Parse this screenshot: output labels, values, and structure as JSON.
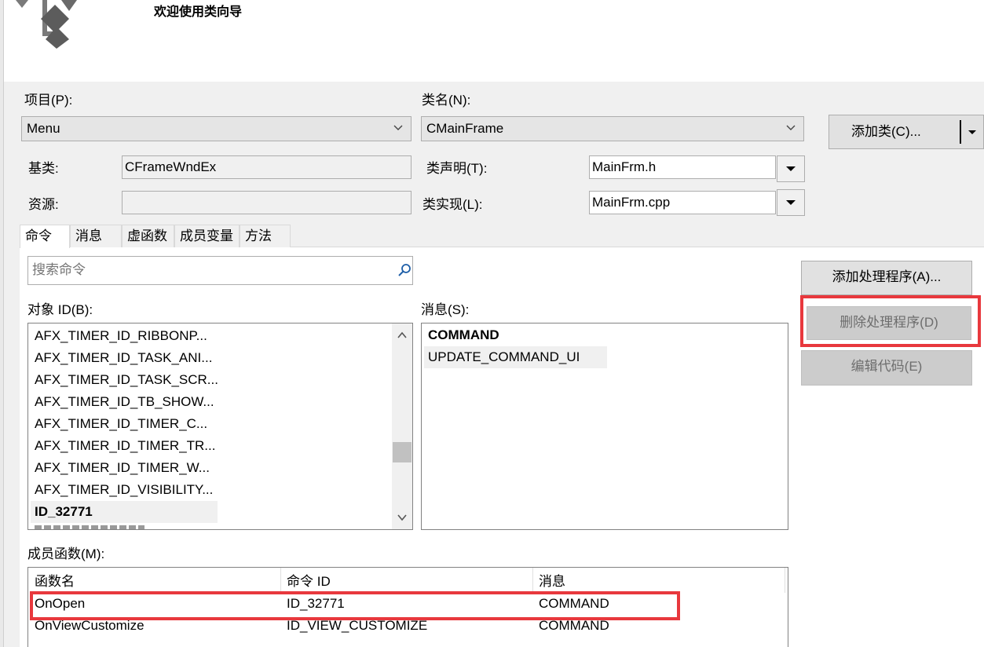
{
  "header": {
    "title": "欢迎使用类向导",
    "logo_icon": "class-wizard-icon"
  },
  "project": {
    "label": "项目(P):",
    "value": "Menu"
  },
  "classname": {
    "label": "类名(N):",
    "value": "CMainFrame"
  },
  "add_class_button": "添加类(C)...",
  "base_class": {
    "label": "基类:",
    "value": "CFrameWndEx"
  },
  "resource": {
    "label": "资源:",
    "value": ""
  },
  "class_decl": {
    "label": "类声明(T):",
    "value": "MainFrm.h"
  },
  "class_impl": {
    "label": "类实现(L):",
    "value": "MainFrm.cpp"
  },
  "tabs": [
    {
      "label": "命令",
      "active": true
    },
    {
      "label": "消息",
      "active": false
    },
    {
      "label": "虚函数",
      "active": false
    },
    {
      "label": "成员变量",
      "active": false
    },
    {
      "label": "方法",
      "active": false
    }
  ],
  "search": {
    "placeholder": "搜索命令"
  },
  "object_ids": {
    "label": "对象 ID(B):",
    "items": [
      "AFX_TIMER_ID_RIBBONP...",
      "AFX_TIMER_ID_TASK_ANI...",
      "AFX_TIMER_ID_TASK_SCR...",
      "AFX_TIMER_ID_TB_SHOW...",
      "AFX_TIMER_ID_TIMER_C...",
      "AFX_TIMER_ID_TIMER_TR...",
      "AFX_TIMER_ID_TIMER_W...",
      "AFX_TIMER_ID_VISIBILITY...",
      "ID_32771"
    ],
    "selected": "ID_32771"
  },
  "messages": {
    "label": "消息(S):",
    "items": [
      "COMMAND",
      "UPDATE_COMMAND_UI"
    ]
  },
  "buttons": {
    "add_handler": "添加处理程序(A)...",
    "delete_handler": "删除处理程序(D)",
    "edit_code": "编辑代码(E)"
  },
  "member_functions": {
    "label": "成员函数(M):",
    "columns": [
      "函数名",
      "命令 ID",
      "消息"
    ],
    "rows": [
      [
        "OnOpen",
        "ID_32771",
        "COMMAND"
      ],
      [
        "OnViewCustomize",
        "ID_VIEW_CUSTOMIZE",
        "COMMAND"
      ]
    ]
  },
  "colors": {
    "highlight_box": "#e8383d",
    "dialog_bg": "#f0f0f0"
  }
}
